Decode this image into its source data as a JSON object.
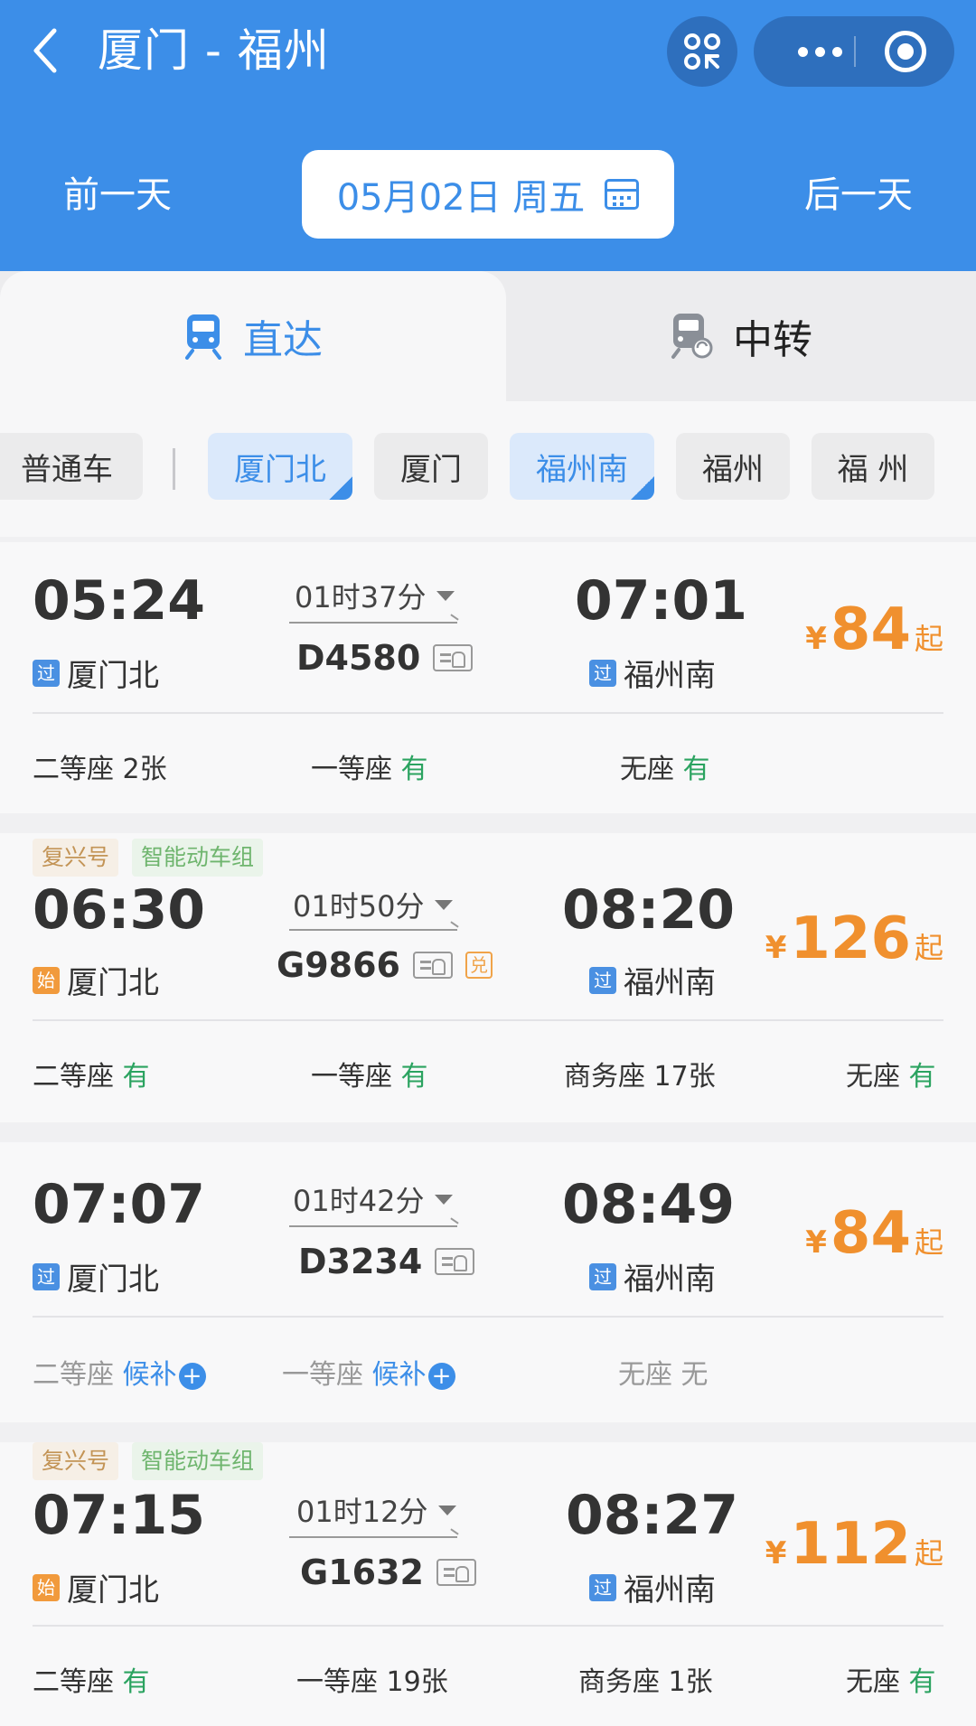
{
  "header": {
    "route": "厦门 - 福州",
    "prev_day": "前一天",
    "next_day": "后一天",
    "date": "05月02日 周五",
    "accent_color": "#3c8ee8"
  },
  "tabs": [
    {
      "label": "直达",
      "icon": "train-icon",
      "active": true
    },
    {
      "label": "中转",
      "icon": "transfer-train-icon",
      "active": false
    }
  ],
  "filters": [
    {
      "label": "普通车",
      "selected": false
    },
    {
      "label": "厦门北",
      "selected": true
    },
    {
      "label": "厦门",
      "selected": false
    },
    {
      "label": "福州南",
      "selected": true
    },
    {
      "label": "福州",
      "selected": false
    },
    {
      "label": "福 州",
      "selected": false
    }
  ],
  "trains": [
    {
      "tags": [],
      "dep_time": "05:24",
      "dep_station": "厦门北",
      "dep_badge": "过",
      "duration": "01时37分",
      "train_no": "D4580",
      "exchange": "",
      "arr_time": "07:01",
      "arr_station": "福州南",
      "arr_badge": "过",
      "price_symbol": "¥",
      "price": "84",
      "price_suffix": "起",
      "seats": [
        {
          "name": "二等座",
          "status": "2张"
        },
        {
          "name": "一等座",
          "status": "有"
        },
        {
          "name": "无座",
          "status": "有"
        }
      ]
    },
    {
      "tags": [
        "复兴号",
        "智能动车组"
      ],
      "dep_time": "06:30",
      "dep_station": "厦门北",
      "dep_badge": "始",
      "duration": "01时50分",
      "train_no": "G9866",
      "exchange": "兑",
      "arr_time": "08:20",
      "arr_station": "福州南",
      "arr_badge": "过",
      "price_symbol": "¥",
      "price": "126",
      "price_suffix": "起",
      "seats": [
        {
          "name": "二等座",
          "status": "有"
        },
        {
          "name": "一等座",
          "status": "有"
        },
        {
          "name": "商务座",
          "status": "17张"
        },
        {
          "name": "无座",
          "status": "有"
        }
      ]
    },
    {
      "tags": [],
      "dep_time": "07:07",
      "dep_station": "厦门北",
      "dep_badge": "过",
      "duration": "01时42分",
      "train_no": "D3234",
      "exchange": "",
      "arr_time": "08:49",
      "arr_station": "福州南",
      "arr_badge": "过",
      "price_symbol": "¥",
      "price": "84",
      "price_suffix": "起",
      "seats": [
        {
          "name": "二等座",
          "status": "候补"
        },
        {
          "name": "一等座",
          "status": "候补"
        },
        {
          "name": "无座",
          "status": "无"
        }
      ]
    },
    {
      "tags": [
        "复兴号",
        "智能动车组"
      ],
      "dep_time": "07:15",
      "dep_station": "厦门北",
      "dep_badge": "始",
      "duration": "01时12分",
      "train_no": "G1632",
      "exchange": "",
      "arr_time": "08:27",
      "arr_station": "福州南",
      "arr_badge": "过",
      "price_symbol": "¥",
      "price": "112",
      "price_suffix": "起",
      "seats": [
        {
          "name": "二等座",
          "status": "有"
        },
        {
          "name": "一等座",
          "status": "19张"
        },
        {
          "name": "商务座",
          "status": "1张"
        },
        {
          "name": "无座",
          "status": "有"
        }
      ]
    }
  ]
}
